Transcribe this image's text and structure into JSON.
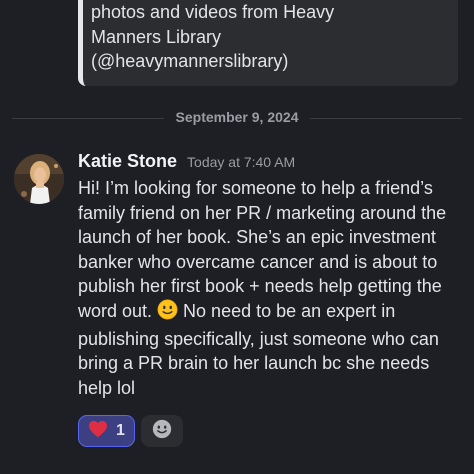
{
  "embed": {
    "text": "photos and videos from Heavy\nManners Library\n(@heavymannerslibrary)"
  },
  "divider": {
    "date": "September 9, 2024"
  },
  "message": {
    "author": "Katie Stone",
    "timestamp": "Today at 7:40 AM",
    "avatar_icon": "profile-photo",
    "body_before_emoji": "Hi! I’m looking for someone to help a friend’s family friend on her PR / marketing around the launch of her book. She’s an epic investment banker who overcame cancer and is about to publish her first book + needs help getting the word out. ",
    "emoji": "slightly-smiling-face",
    "body_after_emoji": " No need to be an expert in publishing specifically, just someone who can bring a PR brain to her launch bc she needs help lol"
  },
  "reactions": [
    {
      "emoji": "red-heart",
      "count": "1",
      "active": true
    }
  ],
  "add_reaction_icon": "add-reaction-icon",
  "colors": {
    "background": "#1e1f24",
    "embed_bg": "#2b2d31",
    "accent": "#5865f2",
    "reaction_active_bg": "#3c3f82"
  }
}
